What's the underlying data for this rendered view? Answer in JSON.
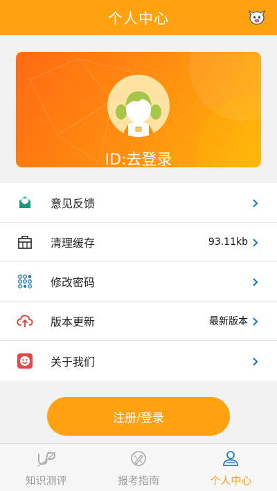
{
  "header": {
    "title": "个人中心",
    "icon": "mascot-icon"
  },
  "profile": {
    "id_text": "ID:去登录",
    "avatar": "girl-avatar"
  },
  "menu": [
    {
      "label": "意见反馈",
      "value": "",
      "icon": "feedback-envelope-icon"
    },
    {
      "label": "清理缓存",
      "value": "93.11kb",
      "icon": "clear-cache-bag-icon"
    },
    {
      "label": "修改密码",
      "value": "",
      "icon": "password-keypad-icon"
    },
    {
      "label": "版本更新",
      "value": "最新版本",
      "icon": "cloud-upload-icon"
    },
    {
      "label": "关于我们",
      "value": "",
      "icon": "smile-face-icon"
    }
  ],
  "login_button": "注册/登录",
  "tabs": [
    {
      "label": "知识测评",
      "icon": "up-logo-icon",
      "active": false
    },
    {
      "label": "报考指南",
      "icon": "compass-pen-icon",
      "active": false
    },
    {
      "label": "个人中心",
      "icon": "person-icon",
      "active": true
    }
  ],
  "colors": {
    "accent": "#ffa20f",
    "icon_blue": "#1a7fc0"
  }
}
